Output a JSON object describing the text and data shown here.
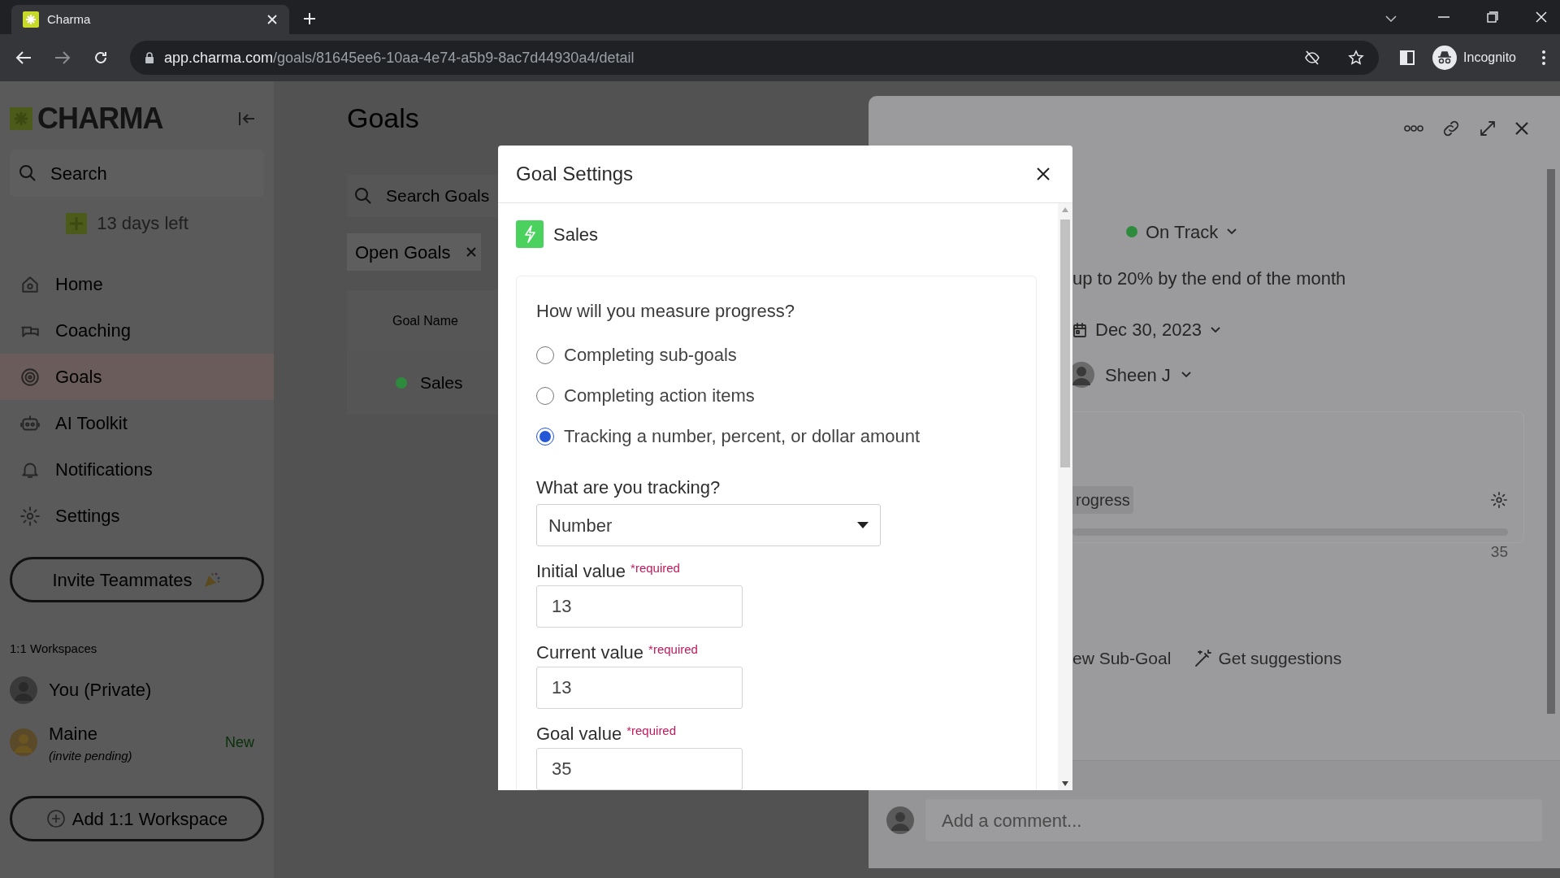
{
  "browser": {
    "tab_title": "Charma",
    "url_host": "app.charma.com",
    "url_path": "/goals/81645ee6-10aa-4e74-a5b9-8ac7d44930a4/detail",
    "profile": "Incognito"
  },
  "sidebar": {
    "logo": "CHARMA",
    "search_placeholder": "Search",
    "trial": "13 days left",
    "nav": [
      {
        "label": "Home",
        "kind": "home",
        "selected": false
      },
      {
        "label": "Coaching",
        "kind": "coaching",
        "selected": false
      },
      {
        "label": "Goals",
        "kind": "goals",
        "selected": true
      },
      {
        "label": "AI Toolkit",
        "kind": "robot",
        "selected": false
      },
      {
        "label": "Notifications",
        "kind": "bell",
        "selected": false
      },
      {
        "label": "Settings",
        "kind": "gear",
        "selected": false
      }
    ],
    "invite_button": "Invite Teammates",
    "workspaces_heading": "1:1 Workspaces",
    "workspaces": [
      {
        "name": "You (Private)"
      },
      {
        "name": "Maine",
        "note": "(invite pending)",
        "badge": "New"
      }
    ],
    "add_workspace": "Add 1:1 Workspace"
  },
  "main": {
    "title": "Goals",
    "search_placeholder": "Search Goals",
    "filter_chip": "Open Goals",
    "column": "Goal Name",
    "rows": [
      {
        "name": "Sales",
        "color": "#2e8b3e"
      }
    ]
  },
  "modal": {
    "title": "Goal Settings",
    "goal_name": "Sales",
    "question": "How will you measure progress?",
    "options": [
      {
        "label": "Completing sub-goals",
        "selected": false
      },
      {
        "label": "Completing action items",
        "selected": false
      },
      {
        "label": "Tracking a number, percent, or dollar amount",
        "selected": true
      }
    ],
    "tracking_label": "What are you tracking?",
    "tracking_value": "Number",
    "fields": [
      {
        "label": "Initial value",
        "required": "*required",
        "value": "13"
      },
      {
        "label": "Current value",
        "required": "*required",
        "value": "13"
      },
      {
        "label": "Goal value",
        "required": "*required",
        "value": "35"
      }
    ]
  },
  "panel": {
    "status": {
      "label": "On Track",
      "color": "#2e8b3e"
    },
    "description": "up to 20% by the end of the month",
    "due_date": "Dec 30, 2023",
    "owner": "Sheen J",
    "progress_tag": "rogress",
    "level": 0,
    "goal_value": "35",
    "actions": [
      {
        "label": "ew Sub-Goal",
        "kind": "plain"
      },
      {
        "label": "Get suggestions",
        "kind": "wand"
      }
    ],
    "comment_placeholder": "Add a comment..."
  }
}
